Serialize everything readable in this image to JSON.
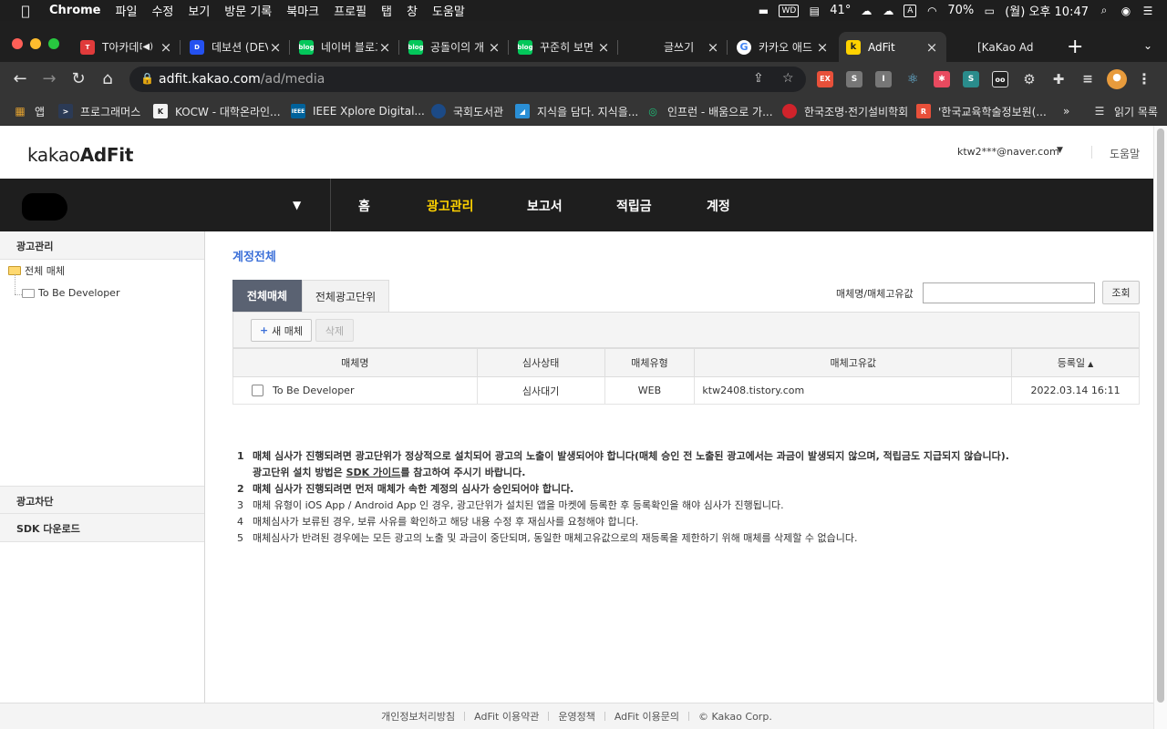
{
  "menubar": {
    "app_name": "Chrome",
    "items": [
      "파일",
      "수정",
      "보기",
      "방문 기록",
      "북마크",
      "프로필",
      "탭",
      "창",
      "도움말"
    ],
    "temperature": "41°",
    "battery": "70%",
    "clock": "(월) 오후 10:47"
  },
  "tabs": [
    {
      "title": "T아카데미"
    },
    {
      "title": "데보션 (DEV"
    },
    {
      "title": "네이버 블로그"
    },
    {
      "title": "공돌이의 개"
    },
    {
      "title": "꾸준히 보면"
    },
    {
      "title": "글쓰기"
    },
    {
      "title": "카카오 애드"
    },
    {
      "title": "AdFit"
    },
    {
      "title": "[KaKao Ad"
    }
  ],
  "address": {
    "host": "adfit.kakao.com",
    "path": "/ad/media"
  },
  "bookmarks": [
    {
      "label": "앱"
    },
    {
      "label": "프로그래머스"
    },
    {
      "label": "KOCW - 대학온라인..."
    },
    {
      "label": "IEEE Xplore Digital..."
    },
    {
      "label": "국회도서관"
    },
    {
      "label": "지식을 담다. 지식을..."
    },
    {
      "label": "인프런 - 배움으로 가..."
    },
    {
      "label": "한국조명·전기설비학회"
    },
    {
      "label": "'한국교육학술정보원(..."
    },
    {
      "label": "읽기 목록"
    }
  ],
  "header": {
    "logo_light": "kakao",
    "logo_bold": "AdFit",
    "account": "ktw2***@naver.com",
    "help": "도움말"
  },
  "gnb": {
    "menu": [
      "홈",
      "광고관리",
      "보고서",
      "적립금",
      "계정"
    ]
  },
  "lnb": {
    "section_ad": "광고관리",
    "tree_root": "전체 매체",
    "tree_child": "To Be Developer",
    "section_block": "광고차단",
    "section_sdk": "SDK 다운로드"
  },
  "content": {
    "title": "계정전체",
    "tab_all_media": "전체매체",
    "tab_all_units": "전체광고단위",
    "search_label": "매체명/매체고유값",
    "search_value": "",
    "search_button": "조회",
    "new_button": "새 매체",
    "delete_button": "삭제"
  },
  "table": {
    "headers": [
      "매체명",
      "심사상태",
      "매체유형",
      "매체고유값",
      "등록일"
    ],
    "rows": [
      {
        "name": "To Be Developer",
        "status": "심사대기",
        "type": "WEB",
        "key": "ktw2408.tistory.com",
        "date": "2022.03.14 16:11"
      }
    ]
  },
  "notes": [
    {
      "num": "1",
      "text": "매체 심사가 진행되려면 광고단위가 정상적으로 설치되어 광고의 노출이 발생되어야 합니다(매체 승인 전 노출된 광고에서는 과금이 발생되지 않으며, 적립금도 지급되지 않습니다)."
    },
    {
      "num": "",
      "pre": "광고단위 설치 방법은 ",
      "link": "SDK 가이드",
      "post": "를 참고하여 주시기 바랍니다."
    },
    {
      "num": "2",
      "text": "매체 심사가 진행되려면 먼저 매체가 속한 계정의 심사가 승인되어야 합니다."
    },
    {
      "num": "3",
      "text": "매체 유형이 iOS App / Android App 인 경우, 광고단위가 설치된 앱을 마켓에 등록한 후 등록확인을 해야 심사가 진행됩니다."
    },
    {
      "num": "4",
      "text": "매체심사가 보류된 경우, 보류 사유를 확인하고 해당 내용 수정 후 재심사를 요청해야 합니다."
    },
    {
      "num": "5",
      "text": "매체심사가 반려된 경우에는 모든 광고의 노출 및 과금이 중단되며, 동일한 매체고유값으로의 재등록을 제한하기 위해 매체를 삭제할 수 없습니다."
    }
  ],
  "footer": [
    "개인정보처리방침",
    "AdFit 이용약관",
    "운영정책",
    "AdFit 이용문의",
    "© Kakao Corp."
  ],
  "colors": {
    "accent": "#3b6fd8",
    "gnb_active": "#ffd200",
    "gnb_bg": "#1e1e1e"
  }
}
